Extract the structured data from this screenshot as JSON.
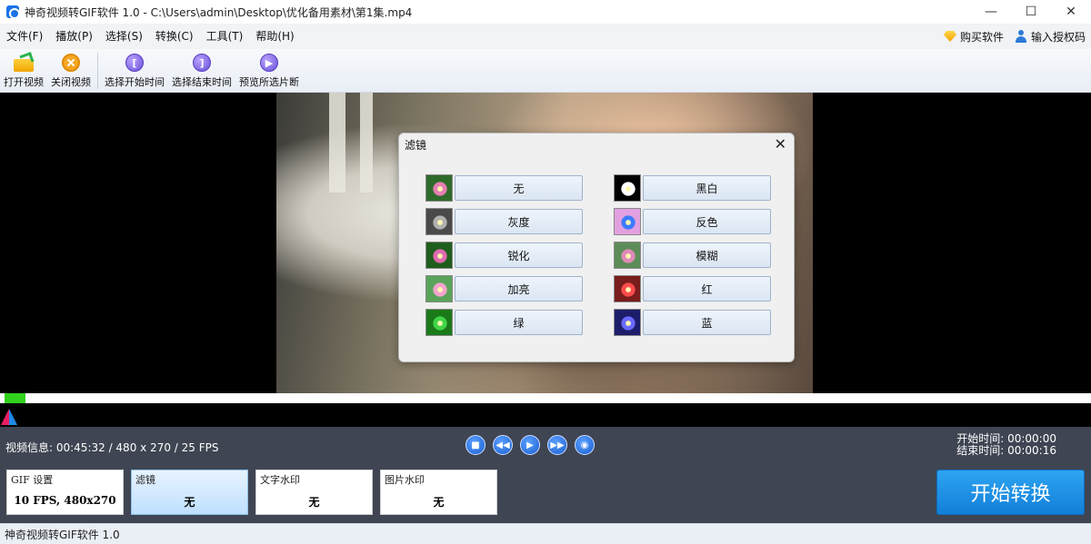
{
  "window": {
    "title": "神奇视频转GIF软件 1.0 - C:\\Users\\admin\\Desktop\\优化备用素材\\第1集.mp4",
    "minimize": "—",
    "maximize": "☐",
    "close": "✕"
  },
  "menu": {
    "items": [
      "文件(F)",
      "播放(P)",
      "选择(S)",
      "转换(C)",
      "工具(T)",
      "帮助(H)"
    ],
    "buy": "购买软件",
    "license": "输入授权码"
  },
  "toolbar": {
    "open": "打开视频",
    "close": "关闭视频",
    "select_start": "选择开始时间",
    "select_end": "选择结束时间",
    "preview": "预览所选片断"
  },
  "dialog": {
    "title": "滤镜",
    "close": "✕",
    "filters": [
      {
        "label": "无",
        "color": "#e57fb3"
      },
      {
        "label": "灰度",
        "color": "#a0a0a0"
      },
      {
        "label": "锐化",
        "color": "#e06ab0"
      },
      {
        "label": "加亮",
        "color": "#f3a4cf"
      },
      {
        "label": "绿",
        "color": "#3fd447"
      },
      {
        "label": "黑白",
        "color": "#ffffff"
      },
      {
        "label": "反色",
        "color": "#6aa0ff"
      },
      {
        "label": "模糊",
        "color": "#df8ab8"
      },
      {
        "label": "红",
        "color": "#e23c3c"
      },
      {
        "label": "蓝",
        "color": "#5b5be2"
      }
    ]
  },
  "playback": {
    "progress_fraction": 0.019
  },
  "info": {
    "video": "视频信息: 00:45:32 / 480 x 270 / 25 FPS",
    "start_time": "开始时间: 00:00:00",
    "end_time": "结束时间: 00:00:16"
  },
  "cards": {
    "gif": {
      "label": "GIF 设置",
      "value": "10 FPS, 480x270"
    },
    "filter": {
      "label": "滤镜",
      "value": "无"
    },
    "text_wm": {
      "label": "文字水印",
      "value": "无"
    },
    "image_wm": {
      "label": "图片水印",
      "value": "无"
    }
  },
  "start_button": "开始转换",
  "statusbar": "神奇视频转GIF软件 1.0"
}
